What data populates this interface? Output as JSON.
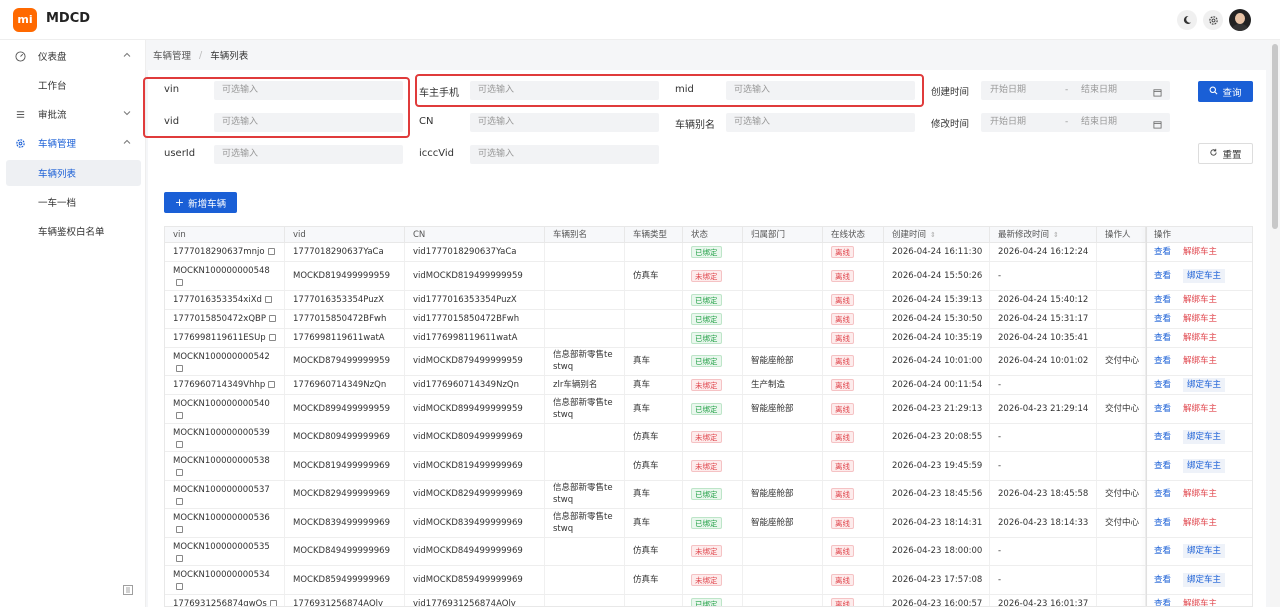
{
  "header": {
    "logo": "mi",
    "title": "MDCD",
    "icons": [
      "moon-icon",
      "gear-icon",
      "avatar"
    ]
  },
  "sidebar": {
    "items": [
      {
        "label": "仪表盘",
        "icon": "dashboard-icon",
        "chevron": "up"
      },
      {
        "label": "工作台"
      },
      {
        "label": "审批流",
        "icon": "list-icon",
        "chevron": "down"
      },
      {
        "label": "车辆管理",
        "icon": "gear-icon",
        "chevron": "up"
      },
      {
        "label": "车辆列表",
        "active": true
      },
      {
        "label": "一车一档"
      },
      {
        "label": "车辆鉴权白名单"
      }
    ]
  },
  "breadcrumb": {
    "root": "车辆管理",
    "sep": "/",
    "current": "车辆列表"
  },
  "filters": {
    "vin": {
      "label": "vin",
      "placeholder": "可选输入"
    },
    "vid": {
      "label": "vid",
      "placeholder": "可选输入"
    },
    "userId": {
      "label": "userId",
      "placeholder": "可选输入"
    },
    "owner_phone": {
      "label": "车主手机",
      "placeholder": "可选输入"
    },
    "cn": {
      "label": "CN",
      "placeholder": "可选输入"
    },
    "icccVid": {
      "label": "icccVid",
      "placeholder": "可选输入"
    },
    "mid": {
      "label": "mid",
      "placeholder": "可选输入"
    },
    "alias": {
      "label": "车辆别名",
      "placeholder": "可选输入"
    },
    "created": {
      "label": "创建时间",
      "start": "开始日期",
      "dash": "-",
      "end": "结束日期"
    },
    "modified": {
      "label": "修改时间",
      "start": "开始日期",
      "dash": "-",
      "end": "结束日期"
    },
    "query_label": "查询",
    "reset_label": "重置"
  },
  "toolbar": {
    "add_label": "新增车辆"
  },
  "table": {
    "columns": [
      "vin",
      "vid",
      "CN",
      "车辆别名",
      "车辆类型",
      "状态",
      "归属部门",
      "在线状态",
      "创建时间",
      "最新修改时间",
      "操作人",
      "操作"
    ],
    "actions": {
      "view": "查看",
      "unbind": "解绑车主",
      "bind": "绑定车主"
    },
    "rows": [
      {
        "vin": "1777018290637mnjo",
        "vid": "1777018290637YaCa",
        "cn": "vid1777018290637YaCa",
        "alias": "",
        "type": "",
        "status": "已绑定",
        "dept": "",
        "online": "离线",
        "created": "2026-04-24 16:11:30",
        "modified": "2026-04-24 16:12:24",
        "operator": ""
      },
      {
        "vin": "MOCKN100000000548",
        "vid": "MOCKD819499999959",
        "cn": "vidMOCKD819499999959",
        "alias": "",
        "type": "仿真车",
        "status": "未绑定",
        "dept": "",
        "online": "离线",
        "created": "2026-04-24 15:50:26",
        "modified": "-",
        "operator": ""
      },
      {
        "vin": "1777016353354xiXd",
        "vid": "1777016353354PuzX",
        "cn": "vid1777016353354PuzX",
        "alias": "",
        "type": "",
        "status": "已绑定",
        "dept": "",
        "online": "离线",
        "created": "2026-04-24 15:39:13",
        "modified": "2026-04-24 15:40:12",
        "operator": ""
      },
      {
        "vin": "1777015850472xQBP",
        "vid": "1777015850472BFwh",
        "cn": "vid1777015850472BFwh",
        "alias": "",
        "type": "",
        "status": "已绑定",
        "dept": "",
        "online": "离线",
        "created": "2026-04-24 15:30:50",
        "modified": "2026-04-24 15:31:17",
        "operator": ""
      },
      {
        "vin": "1776998119611ESUp",
        "vid": "1776998119611watA",
        "cn": "vid1776998119611watA",
        "alias": "",
        "type": "",
        "status": "已绑定",
        "dept": "",
        "online": "离线",
        "created": "2026-04-24 10:35:19",
        "modified": "2026-04-24 10:35:41",
        "operator": ""
      },
      {
        "vin": "MOCKN100000000542",
        "vid": "MOCKD879499999959",
        "cn": "vidMOCKD879499999959",
        "alias": "信息部新零售te stwq",
        "type": "真车",
        "status": "已绑定",
        "dept": "智能座舱部",
        "online": "离线",
        "created": "2026-04-24 10:01:00",
        "modified": "2026-04-24 10:01:02",
        "operator": "交付中心"
      },
      {
        "vin": "1776960714349Vhhp",
        "vid": "1776960714349NzQn",
        "cn": "vid1776960714349NzQn",
        "alias": "zlr车辆别名",
        "type": "真车",
        "status": "未绑定",
        "dept": "生产制造",
        "online": "离线",
        "created": "2026-04-24 00:11:54",
        "modified": "-",
        "operator": ""
      },
      {
        "vin": "MOCKN100000000540",
        "vid": "MOCKD899499999959",
        "cn": "vidMOCKD899499999959",
        "alias": "信息部新零售te stwq",
        "type": "真车",
        "status": "已绑定",
        "dept": "智能座舱部",
        "online": "离线",
        "created": "2026-04-23 21:29:13",
        "modified": "2026-04-23 21:29:14",
        "operator": "交付中心"
      },
      {
        "vin": "MOCKN100000000539",
        "vid": "MOCKD809499999969",
        "cn": "vidMOCKD809499999969",
        "alias": "",
        "type": "仿真车",
        "status": "未绑定",
        "dept": "",
        "online": "离线",
        "created": "2026-04-23 20:08:55",
        "modified": "-",
        "operator": ""
      },
      {
        "vin": "MOCKN100000000538",
        "vid": "MOCKD819499999969",
        "cn": "vidMOCKD819499999969",
        "alias": "",
        "type": "仿真车",
        "status": "未绑定",
        "dept": "",
        "online": "离线",
        "created": "2026-04-23 19:45:59",
        "modified": "-",
        "operator": ""
      },
      {
        "vin": "MOCKN100000000537",
        "vid": "MOCKD829499999969",
        "cn": "vidMOCKD829499999969",
        "alias": "信息部新零售te stwq",
        "type": "真车",
        "status": "已绑定",
        "dept": "智能座舱部",
        "online": "离线",
        "created": "2026-04-23 18:45:56",
        "modified": "2026-04-23 18:45:58",
        "operator": "交付中心"
      },
      {
        "vin": "MOCKN100000000536",
        "vid": "MOCKD839499999969",
        "cn": "vidMOCKD839499999969",
        "alias": "信息部新零售te stwq",
        "type": "真车",
        "status": "已绑定",
        "dept": "智能座舱部",
        "online": "离线",
        "created": "2026-04-23 18:14:31",
        "modified": "2026-04-23 18:14:33",
        "operator": "交付中心"
      },
      {
        "vin": "MOCKN100000000535",
        "vid": "MOCKD849499999969",
        "cn": "vidMOCKD849499999969",
        "alias": "",
        "type": "仿真车",
        "status": "未绑定",
        "dept": "",
        "online": "离线",
        "created": "2026-04-23 18:00:00",
        "modified": "-",
        "operator": ""
      },
      {
        "vin": "MOCKN100000000534",
        "vid": "MOCKD859499999969",
        "cn": "vidMOCKD859499999969",
        "alias": "",
        "type": "仿真车",
        "status": "未绑定",
        "dept": "",
        "online": "离线",
        "created": "2026-04-23 17:57:08",
        "modified": "-",
        "operator": ""
      },
      {
        "vin": "1776931256874qwQs",
        "vid": "1776931256874AQly",
        "cn": "vid1776931256874AQly",
        "alias": "",
        "type": "",
        "status": "已绑定",
        "dept": "",
        "online": "离线",
        "created": "2026-04-23 16:00:57",
        "modified": "2026-04-23 16:01:37",
        "operator": ""
      }
    ]
  },
  "colors": {
    "accent": "#1a5fd6",
    "danger": "#e0464d",
    "success": "#24a148",
    "highlight": "#e03b3b"
  }
}
